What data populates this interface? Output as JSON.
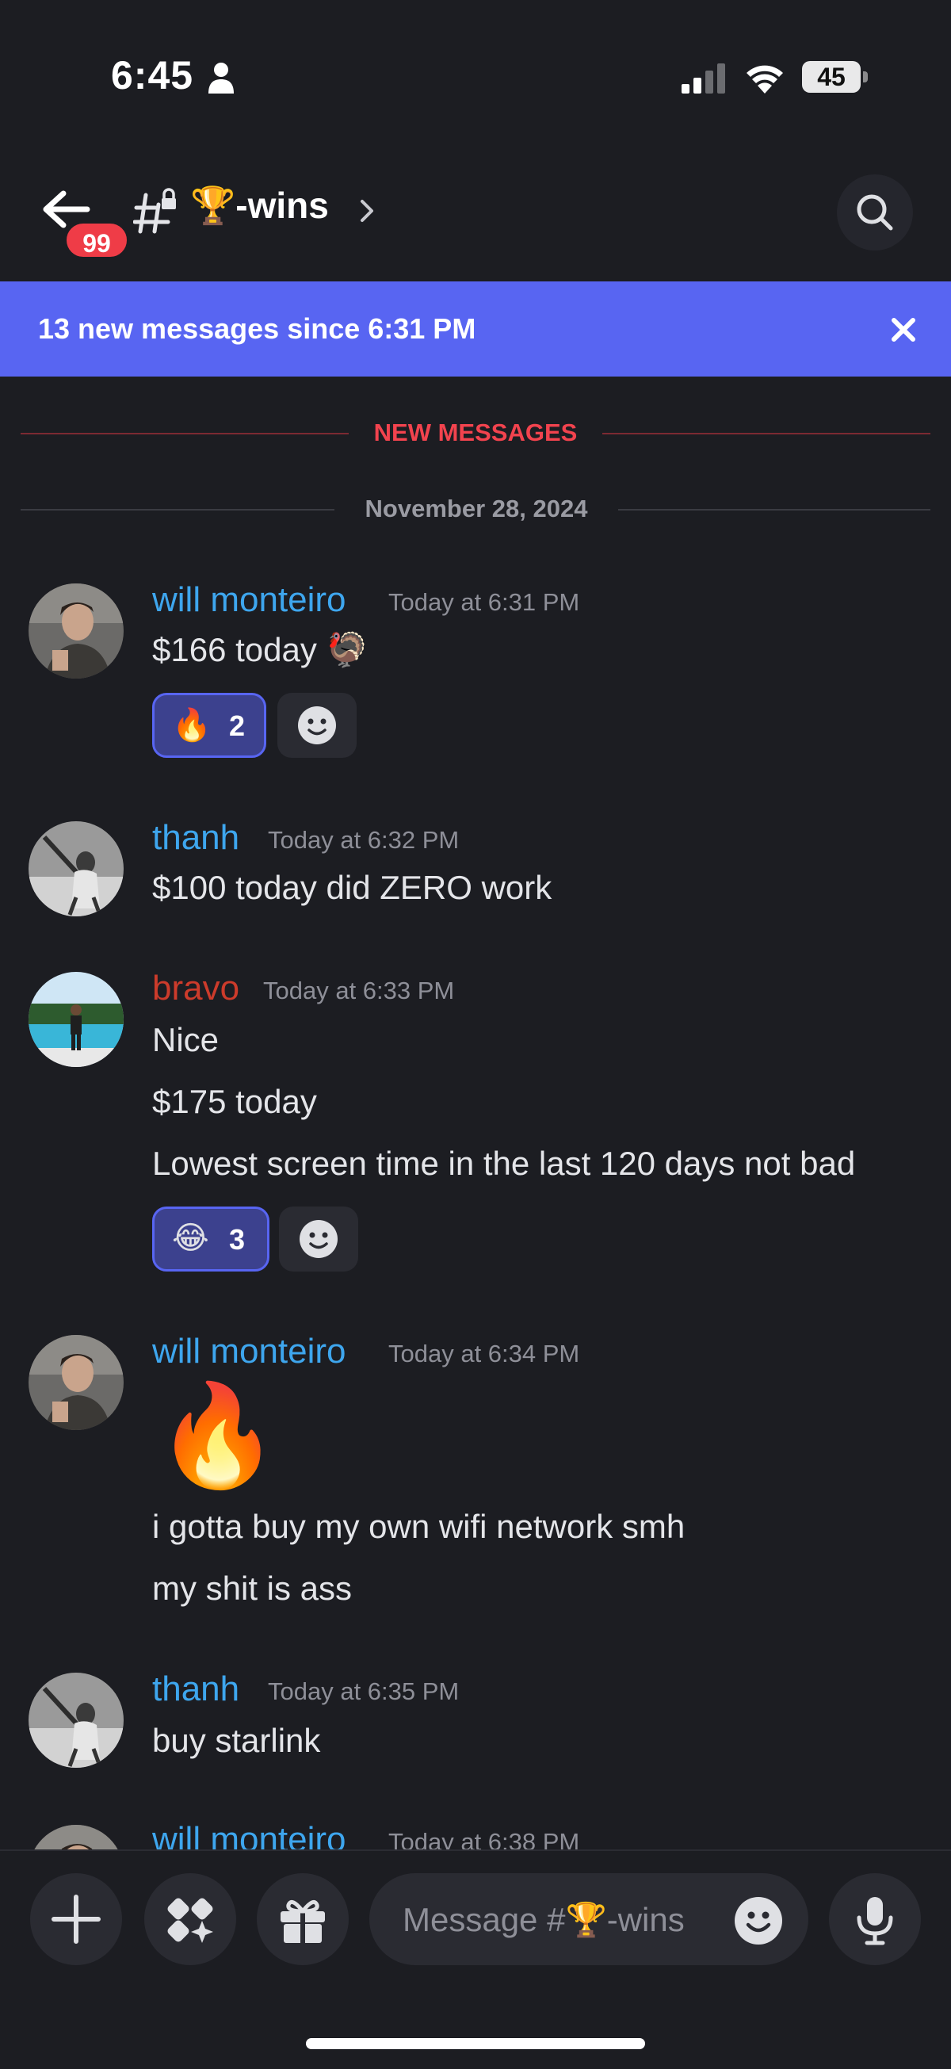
{
  "status_bar": {
    "time": "6:45",
    "battery": "45"
  },
  "header": {
    "unread_badge": "99",
    "channel_emoji": "🏆",
    "channel_suffix": "-wins"
  },
  "banner": {
    "text": "13 new messages since 6:31 PM"
  },
  "dividers": {
    "new_messages": "NEW MESSAGES",
    "date": "November 28, 2024"
  },
  "messages": [
    {
      "author": "will monteiro",
      "time": "Today at 6:31 PM",
      "lines": [
        "$166 today 🦃"
      ],
      "reaction": {
        "emoji": "🔥",
        "count": "2"
      }
    },
    {
      "author": "thanh",
      "time": "Today at 6:32 PM",
      "lines": [
        "$100 today did ZERO work"
      ]
    },
    {
      "author": "bravo",
      "time": "Today at 6:33 PM",
      "lines": [
        "Nice",
        "$175 today",
        "Lowest screen time in the last 120 days not bad"
      ],
      "reaction": {
        "emoji": "😂",
        "count": "3"
      }
    },
    {
      "author": "will monteiro",
      "time": "Today at 6:34 PM",
      "lines": [
        "🔥",
        "i gotta buy my own wifi network smh",
        "my shit is ass"
      ]
    },
    {
      "author": "thanh",
      "time": "Today at 6:35 PM",
      "lines": [
        "buy starlink"
      ]
    },
    {
      "author": "will monteiro",
      "time": "Today at 6:38 PM",
      "lines": []
    }
  ],
  "composer": {
    "placeholder": "Message #🏆-wins"
  },
  "colors": {
    "accent": "#5865f2",
    "background": "#1c1d22",
    "alert_red": "#f2434e",
    "author_blue": "#3ea6ee",
    "author_red": "#cc3b2b"
  }
}
